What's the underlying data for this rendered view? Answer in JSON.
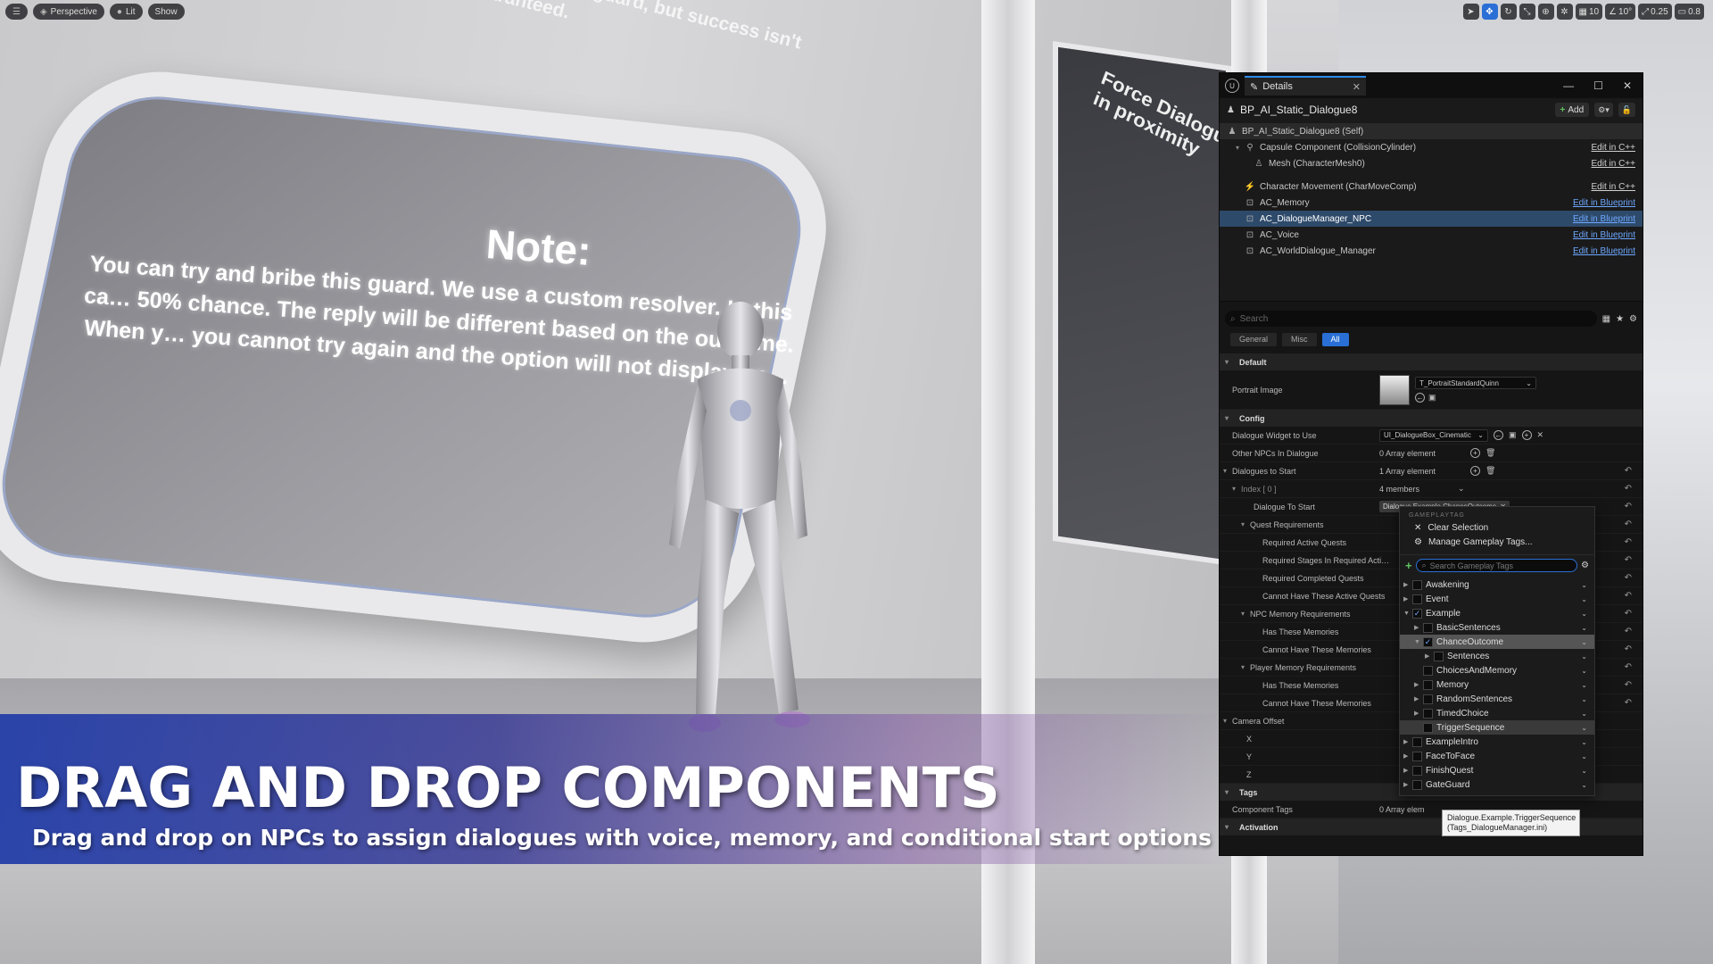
{
  "viewport": {
    "toolbar_left": [
      {
        "label": "Perspective",
        "icon": "cube-icon"
      },
      {
        "label": "Lit",
        "icon": "sphere-icon"
      },
      {
        "label": "Show",
        "icon": ""
      }
    ],
    "toolbar_right": {
      "grid_size": "10",
      "rotation_snap": "10°",
      "scale_snap": "0.25",
      "camera_speed": "0.8"
    },
    "scene_text": {
      "top_text": "…ing. …ult. a guard, but success isn't guaranteed.",
      "note_title": "Note:",
      "note_body": "You can try and bribe this guard. We use a custom resolver. In this ca… 50% chance. The reply will be different based on the outcome. When y… you cannot try again and the option will not display an…",
      "side_panel_text": "Force Dialogue in proximity"
    }
  },
  "banner": {
    "title": "DRAG AND DROP COMPONENTS",
    "subtitle": "Drag and drop on NPCs to assign dialogues with voice, memory, and conditional start options"
  },
  "details": {
    "tab_label": "Details",
    "actor_name": "BP_AI_Static_Dialogue8",
    "add_label": "Add",
    "components": [
      {
        "label": "BP_AI_Static_Dialogue8 (Self)",
        "edit": "",
        "indent": 0
      },
      {
        "label": "Capsule Component (CollisionCylinder)",
        "edit": "Edit in C++",
        "indent": 1
      },
      {
        "label": "Mesh (CharacterMesh0)",
        "edit": "Edit in C++",
        "indent": 2
      },
      {
        "label": "Character Movement (CharMoveComp)",
        "edit": "Edit in C++",
        "indent": 1
      },
      {
        "label": "AC_Memory",
        "edit": "Edit in Blueprint",
        "indent": 1
      },
      {
        "label": "AC_DialogueManager_NPC",
        "edit": "Edit in Blueprint",
        "indent": 1
      },
      {
        "label": "AC_Voice",
        "edit": "Edit in Blueprint",
        "indent": 1
      },
      {
        "label": "AC_WorldDialogue_Manager",
        "edit": "Edit in Blueprint",
        "indent": 1
      }
    ],
    "search_placeholder": "Search",
    "filters": [
      "General",
      "Misc",
      "All"
    ],
    "categories": {
      "default": "Default",
      "config": "Config",
      "tags": "Tags",
      "activation": "Activation"
    },
    "props": {
      "portrait_image": "Portrait Image",
      "portrait_value": "T_PortraitStandardQuinn",
      "dialogue_widget": "Dialogue Widget to Use",
      "dialogue_widget_value": "UI_DialogueBox_Cinematic",
      "other_npcs": "Other NPCs In Dialogue",
      "other_npcs_value": "0 Array element",
      "dialogues_to_start": "Dialogues to Start",
      "dialogues_to_start_value": "1 Array element",
      "index0": "Index [ 0 ]",
      "index0_value": "4 members",
      "dialogue_to_start": "Dialogue To Start",
      "dialogue_to_start_value": "Dialogue.Example.ChanceOutcome",
      "quest_req": "Quest Requirements",
      "req_active_quests": "Required Active Quests",
      "req_stages": "Required Stages In Required Acti…",
      "req_completed": "Required Completed Quests",
      "cannot_active": "Cannot Have These Active Quests",
      "npc_memory_req": "NPC Memory Requirements",
      "has_memories": "Has These Memories",
      "cannot_memories": "Cannot Have These Memories",
      "player_memory_req": "Player Memory Requirements",
      "player_has_memories": "Has These Memories",
      "player_cannot_memories": "Cannot Have These Memories",
      "camera_offset": "Camera Offset",
      "x": "X",
      "y": "Y",
      "z": "Z",
      "component_tags": "Component Tags",
      "component_tags_value": "0 Array elem"
    }
  },
  "tag_popup": {
    "header": "GAMEPLAYTAG",
    "clear_selection": "Clear Selection",
    "manage_tags": "Manage Gameplay Tags...",
    "search_placeholder": "Search Gameplay Tags",
    "tags": [
      {
        "label": "Awakening",
        "level": 1,
        "checked": false,
        "expanded": false,
        "hl": ""
      },
      {
        "label": "Event",
        "level": 1,
        "checked": false,
        "expanded": false,
        "hl": ""
      },
      {
        "label": "Example",
        "level": 1,
        "checked": true,
        "expanded": true,
        "hl": ""
      },
      {
        "label": "BasicSentences",
        "level": 2,
        "checked": false,
        "expanded": false,
        "hl": ""
      },
      {
        "label": "ChanceOutcome",
        "level": 2,
        "checked": true,
        "expanded": true,
        "hl": "hl2"
      },
      {
        "label": "Sentences",
        "level": 3,
        "checked": false,
        "expanded": false,
        "hl": ""
      },
      {
        "label": "ChoicesAndMemory",
        "level": 2,
        "checked": false,
        "expanded": null,
        "hl": ""
      },
      {
        "label": "Memory",
        "level": 2,
        "checked": false,
        "expanded": false,
        "hl": ""
      },
      {
        "label": "RandomSentences",
        "level": 2,
        "checked": false,
        "expanded": false,
        "hl": ""
      },
      {
        "label": "TimedChoice",
        "level": 2,
        "checked": false,
        "expanded": false,
        "hl": ""
      },
      {
        "label": "TriggerSequence",
        "level": 2,
        "checked": false,
        "expanded": null,
        "hl": "hl"
      },
      {
        "label": "ExampleIntro",
        "level": 1,
        "checked": false,
        "expanded": false,
        "hl": ""
      },
      {
        "label": "FaceToFace",
        "level": 1,
        "checked": false,
        "expanded": false,
        "hl": ""
      },
      {
        "label": "FinishQuest",
        "level": 1,
        "checked": false,
        "expanded": false,
        "hl": ""
      },
      {
        "label": "GateGuard",
        "level": 1,
        "checked": false,
        "expanded": false,
        "hl": ""
      }
    ],
    "tooltip_line1": "Dialogue.Example.TriggerSequence",
    "tooltip_line2": "(Tags_DialogueManager.ini)"
  }
}
